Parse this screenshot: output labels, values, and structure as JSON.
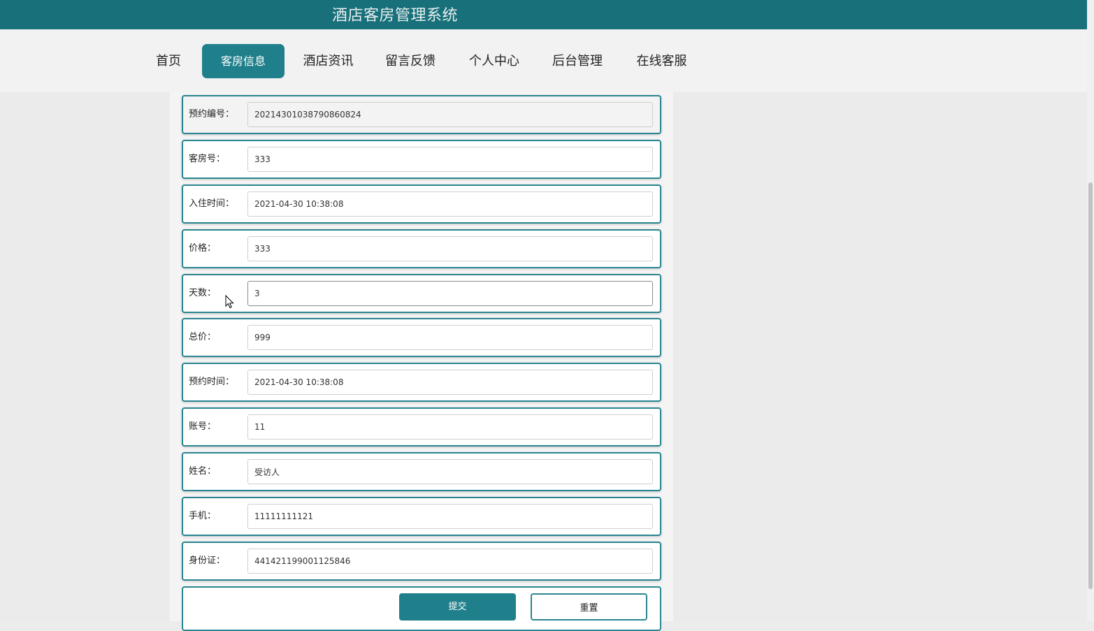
{
  "header": {
    "title": "酒店客房管理系统"
  },
  "nav": {
    "items": [
      {
        "label": "首页"
      },
      {
        "label": "客房信息",
        "active": true
      },
      {
        "label": "酒店资讯"
      },
      {
        "label": "留言反馈"
      },
      {
        "label": "个人中心"
      },
      {
        "label": "后台管理"
      },
      {
        "label": "在线客服"
      }
    ]
  },
  "form": {
    "fields": [
      {
        "label": "预约编号：",
        "value": "20214301038790860824",
        "readonly": true
      },
      {
        "label": "客房号：",
        "value": "333"
      },
      {
        "label": "入住时间：",
        "value": "2021-04-30 10:38:08"
      },
      {
        "label": "价格：",
        "value": "333"
      },
      {
        "label": "天数：",
        "value": "3",
        "focused": true
      },
      {
        "label": "总价：",
        "value": "999"
      },
      {
        "label": "预约时间：",
        "value": "2021-04-30 10:38:08"
      },
      {
        "label": "账号：",
        "value": "11"
      },
      {
        "label": "姓名：",
        "value": "受访人"
      },
      {
        "label": "手机：",
        "value": "11111111121"
      },
      {
        "label": "身份证：",
        "value": "441421199001125846"
      }
    ],
    "submit_label": "提交",
    "reset_label": "重置"
  },
  "colors": {
    "header_bg": "#17707a",
    "accent": "#1f808b",
    "border": "#2a8592",
    "page_bg": "#ececec"
  },
  "icons": {
    "cursor": "mouse-pointer-icon"
  }
}
